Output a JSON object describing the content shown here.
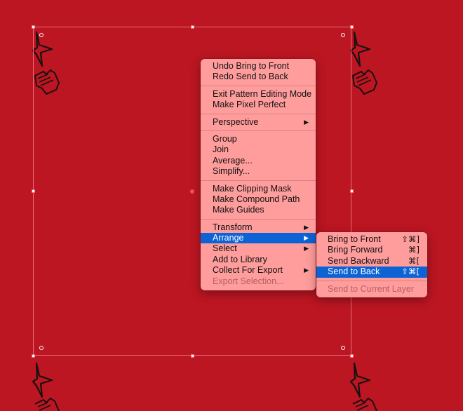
{
  "context_menu": {
    "groups": [
      [
        {
          "label": "Undo Bring to Front"
        },
        {
          "label": "Redo Send to Back"
        }
      ],
      [
        {
          "label": "Exit Pattern Editing Mode"
        },
        {
          "label": "Make Pixel Perfect"
        }
      ],
      [
        {
          "label": "Perspective",
          "submenu": true
        }
      ],
      [
        {
          "label": "Group"
        },
        {
          "label": "Join"
        },
        {
          "label": "Average..."
        },
        {
          "label": "Simplify..."
        }
      ],
      [
        {
          "label": "Make Clipping Mask"
        },
        {
          "label": "Make Compound Path"
        },
        {
          "label": "Make Guides"
        }
      ],
      [
        {
          "label": "Transform",
          "submenu": true
        },
        {
          "label": "Arrange",
          "submenu": true,
          "highlighted": true
        },
        {
          "label": "Select",
          "submenu": true
        },
        {
          "label": "Add to Library"
        },
        {
          "label": "Collect For Export",
          "submenu": true
        },
        {
          "label": "Export Selection...",
          "disabled": true
        }
      ]
    ],
    "submenu_arrow": "▶"
  },
  "arrange_submenu": {
    "groups": [
      [
        {
          "label": "Bring to Front",
          "shortcut": "⇧⌘]"
        },
        {
          "label": "Bring Forward",
          "shortcut": "⌘]"
        },
        {
          "label": "Send Backward",
          "shortcut": "⌘["
        },
        {
          "label": "Send to Back",
          "shortcut": "⇧⌘[",
          "highlighted": true
        }
      ],
      [
        {
          "label": "Send to Current Layer",
          "disabled": true
        }
      ]
    ]
  },
  "colors": {
    "canvas_background": "#bb1622",
    "menu_background": "#ff9c9c",
    "highlight": "#0b63d6",
    "selection_stroke": "#f06a78",
    "pattern_ink": "#1a1010"
  },
  "icons": {
    "pattern_star": "star-doodle-icon",
    "pattern_mitten": "mitten-doodle-icon"
  }
}
